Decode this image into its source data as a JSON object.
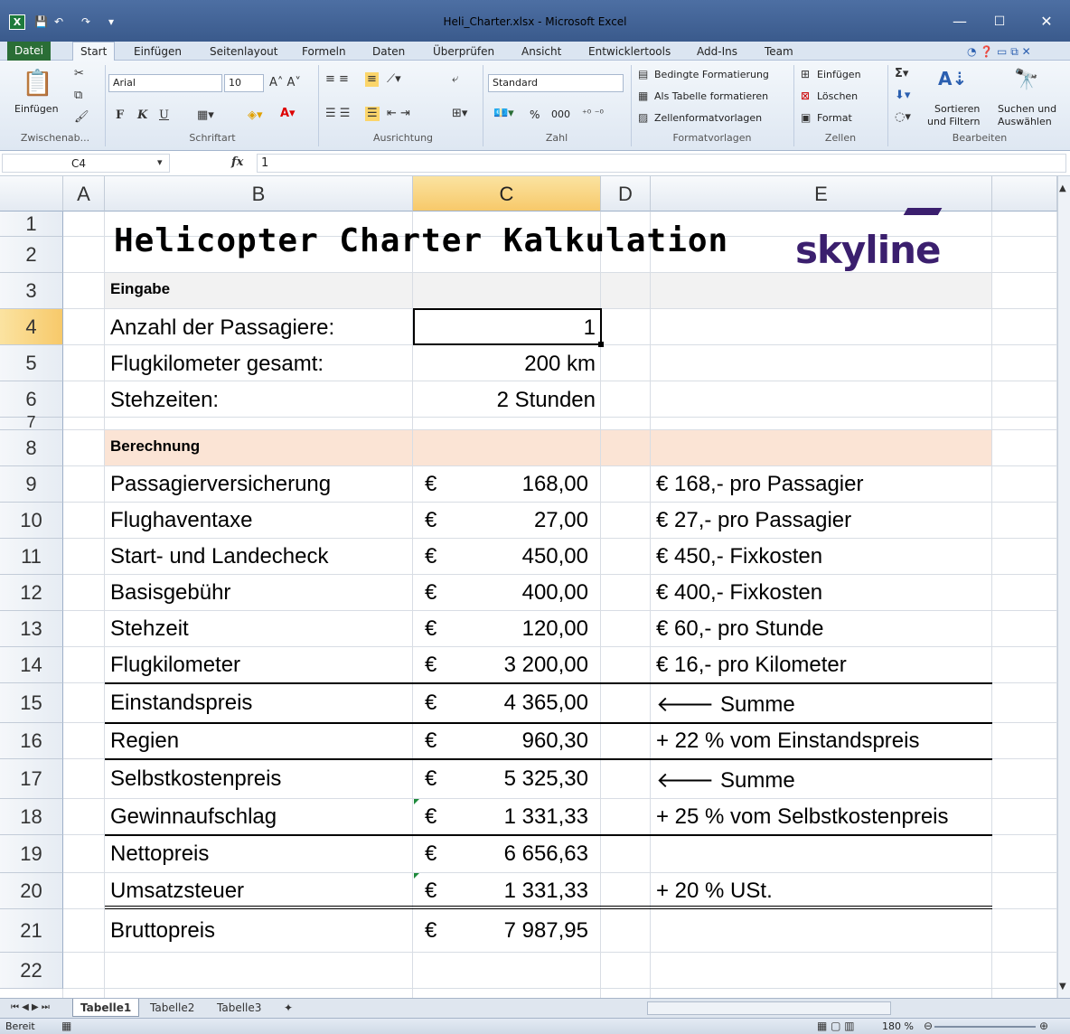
{
  "window": {
    "title": "Heli_Charter.xlsx - Microsoft Excel",
    "app_icon": "excel-icon",
    "minimize": "—",
    "maximize": "☐",
    "close": "✕"
  },
  "ribbon_tabs": [
    "Datei",
    "Start",
    "Einfügen",
    "Seitenlayout",
    "Formeln",
    "Daten",
    "Überprüfen",
    "Ansicht",
    "Entwicklertools",
    "Add-Ins",
    "Team"
  ],
  "ribbon": {
    "clipboard": {
      "paste": "Einfügen",
      "label": "Zwischenab..."
    },
    "font": {
      "name": "Arial",
      "size": "10",
      "bold": "F",
      "italic": "K",
      "underline": "U",
      "label": "Schriftart"
    },
    "alignment": {
      "label": "Ausrichtung"
    },
    "number": {
      "format": "Standard",
      "percent": "%",
      "thousands": "000",
      "label": "Zahl"
    },
    "styles": {
      "conditional": "Bedingte Formatierung",
      "as_table": "Als Tabelle formatieren",
      "cell_styles": "Zellenformatvorlagen",
      "label": "Formatvorlagen"
    },
    "cells": {
      "insert": "Einfügen",
      "delete": "Löschen",
      "format": "Format",
      "label": "Zellen"
    },
    "editing": {
      "sort1": "Sortieren",
      "sort2": "und Filtern",
      "find1": "Suchen und",
      "find2": "Auswählen",
      "label": "Bearbeiten"
    }
  },
  "formula_bar": {
    "name_box": "C4",
    "fx": "fx",
    "value": "1"
  },
  "columns": [
    "A",
    "B",
    "C",
    "D",
    "E"
  ],
  "rows": [
    "1",
    "2",
    "3",
    "4",
    "5",
    "6",
    "7",
    "8",
    "9",
    "10",
    "11",
    "12",
    "13",
    "14",
    "15",
    "16",
    "17",
    "18",
    "19",
    "20",
    "21",
    "22"
  ],
  "sheet": {
    "title": "Helicopter Charter Kalkulation",
    "logo": "skyline",
    "section_input": "Eingabe",
    "inputs": [
      {
        "label": "Anzahl der Passagiere:",
        "value": "1"
      },
      {
        "label": "Flugkilometer gesamt:",
        "value": "200 km"
      },
      {
        "label": "Stehzeiten:",
        "value": "2 Stunden"
      }
    ],
    "section_calc": "Berechnung",
    "currency": "€",
    "calc": [
      {
        "label": "Passagierversicherung",
        "value": "168,00",
        "note": "€ 168,- pro Passagier"
      },
      {
        "label": "Flughaventaxe",
        "value": "27,00",
        "note": "€ 27,- pro Passagier"
      },
      {
        "label": "Start- und Landecheck",
        "value": "450,00",
        "note": "€ 450,- Fixkosten"
      },
      {
        "label": "Basisgebühr",
        "value": "400,00",
        "note": "€ 400,- Fixkosten"
      },
      {
        "label": "Stehzeit",
        "value": "120,00",
        "note": "€ 60,- pro Stunde"
      },
      {
        "label": "Flugkilometer",
        "value": "3 200,00",
        "note": "€ 16,- pro Kilometer"
      },
      {
        "label": "Einstandspreis",
        "value": "4 365,00",
        "note": "🡐 Summe"
      },
      {
        "label": "Regien",
        "value": "960,30",
        "note": " + 22 % vom Einstandspreis"
      },
      {
        "label": "Selbstkostenpreis",
        "value": "5 325,30",
        "note": "🡐 Summe"
      },
      {
        "label": "Gewinnaufschlag",
        "value": "1 331,33",
        "note": "+ 25 % vom Selbstkostenpreis"
      },
      {
        "label": "Nettopreis",
        "value": "6 656,63",
        "note": ""
      },
      {
        "label": "Umsatzsteuer",
        "value": "1 331,33",
        "note": "+ 20 % USt."
      },
      {
        "label": "Bruttopreis",
        "value": "7 987,95",
        "note": ""
      }
    ]
  },
  "sheet_tabs": [
    "Tabelle1",
    "Tabelle2",
    "Tabelle3"
  ],
  "status": {
    "ready": "Bereit",
    "zoom": "180 %"
  },
  "colors": {
    "accent": "#2a6e36",
    "input_band": "#f2f2f2",
    "calc_band": "#fbe4d5",
    "logo": "#3b1f6e"
  }
}
